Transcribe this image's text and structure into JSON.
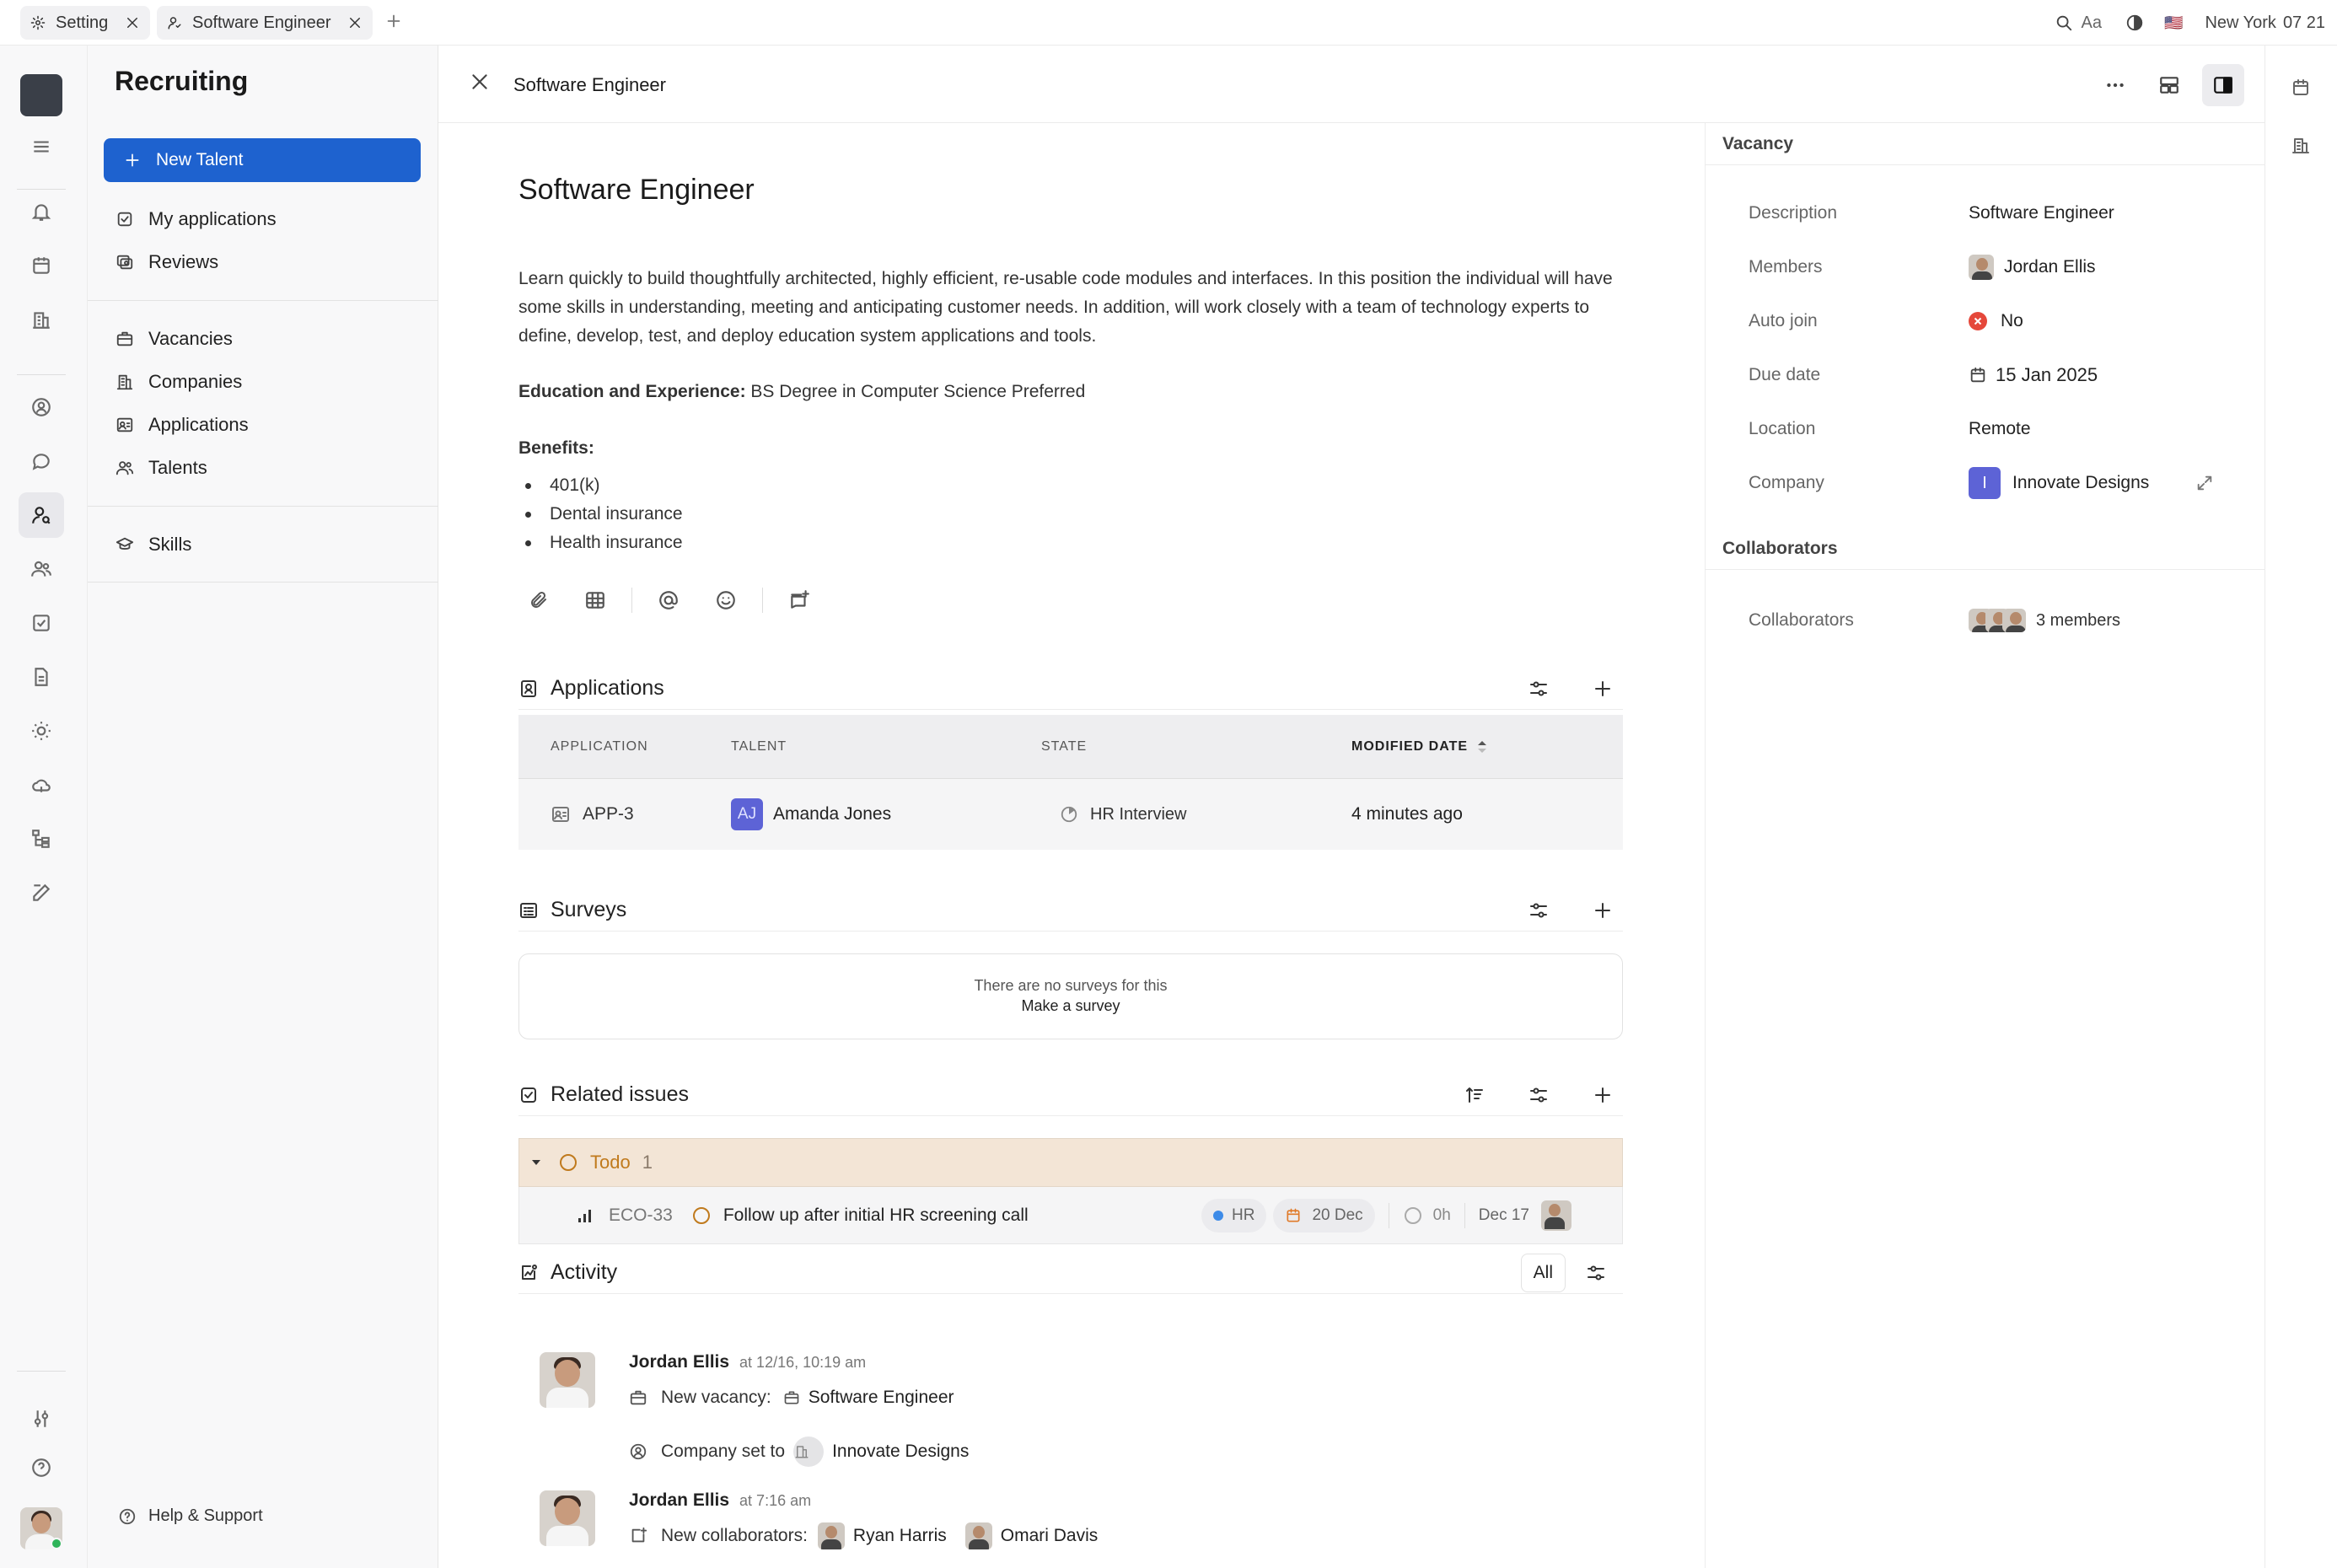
{
  "topbar": {
    "tabs": [
      {
        "label": "Setting",
        "icon": "gear-icon"
      },
      {
        "label": "Software Engineer",
        "icon": "talent-icon"
      }
    ],
    "font_label": "Aa",
    "flag": "🇺🇸",
    "location": "New York",
    "time": "07 21"
  },
  "sidebar": {
    "title": "Recruiting",
    "new_button": "New Talent",
    "group1": [
      {
        "label": "My applications",
        "icon": "checkbox-icon"
      },
      {
        "label": "Reviews",
        "icon": "reviews-icon"
      }
    ],
    "group2": [
      {
        "label": "Vacancies",
        "icon": "briefcase-icon"
      },
      {
        "label": "Companies",
        "icon": "building-icon"
      },
      {
        "label": "Applications",
        "icon": "id-card-icon"
      },
      {
        "label": "Talents",
        "icon": "people-icon"
      }
    ],
    "group3": [
      {
        "label": "Skills",
        "icon": "graduation-cap-icon"
      }
    ],
    "help": "Help & Support"
  },
  "header": {
    "title": "Software Engineer"
  },
  "doc": {
    "title": "Software Engineer",
    "description": "Learn quickly to build thoughtfully architected, highly efficient, re-usable code modules and interfaces. In this position the individual will have some skills in understanding, meeting and anticipating customer needs. In addition, will work closely with a team of technology experts to define, develop, test, and deploy education system applications and tools.",
    "edu_label": "Education and Experience:",
    "edu_value": " BS Degree in Computer Science Preferred",
    "benefits_label": "Benefits:",
    "benefits": [
      "401(k)",
      "Dental insurance",
      "Health insurance"
    ]
  },
  "applications": {
    "title": "Applications",
    "columns": [
      "APPLICATION",
      "TALENT",
      "STATE",
      "MODIFIED DATE"
    ],
    "rows": [
      {
        "id": "APP-3",
        "initials": "AJ",
        "talent": "Amanda Jones",
        "state": "HR Interview",
        "modified": "4 minutes ago"
      }
    ]
  },
  "surveys": {
    "title": "Surveys",
    "empty_text": "There are no surveys for this",
    "make_link": "Make a survey"
  },
  "related": {
    "title": "Related issues",
    "group_label": "Todo",
    "group_count": "1",
    "issue": {
      "id": "ECO-33",
      "title": "Follow up after initial HR screening call",
      "label": "HR",
      "due": "20 Dec",
      "estimate": "0h",
      "date": "Dec 17"
    }
  },
  "activity": {
    "title": "Activity",
    "filter": "All",
    "entries": [
      {
        "author": "Jordan Ellis",
        "time": "at 12/16, 10:19 am",
        "line1_label": "New vacancy:",
        "line1_value": "Software Engineer",
        "line2_label": "Company set to",
        "line2_value": "Innovate Designs"
      },
      {
        "author": "Jordan Ellis",
        "time": "at 7:16 am",
        "line1_label": "New collaborators:",
        "person1": "Ryan Harris",
        "person2": "Omari Davis"
      }
    ]
  },
  "props": {
    "vacancy_header": "Vacancy",
    "rows": {
      "description": {
        "label": "Description",
        "value": "Software Engineer"
      },
      "members": {
        "label": "Members",
        "value": "Jordan Ellis"
      },
      "auto_join": {
        "label": "Auto join",
        "value": "No"
      },
      "due_date": {
        "label": "Due date",
        "value": "15 Jan 2025"
      },
      "location": {
        "label": "Location",
        "value": "Remote"
      },
      "company": {
        "label": "Company",
        "value": "Innovate Designs",
        "initial": "I"
      }
    },
    "collab_header": "Collaborators",
    "collaborators": {
      "label": "Collaborators",
      "value": "3 members"
    }
  },
  "colors": {
    "accent": "#1e62cf",
    "todo_bg": "#f3e5d6",
    "todo_text": "#c07a1d",
    "company_chip": "#5d63d6",
    "danger": "#e5483b"
  }
}
